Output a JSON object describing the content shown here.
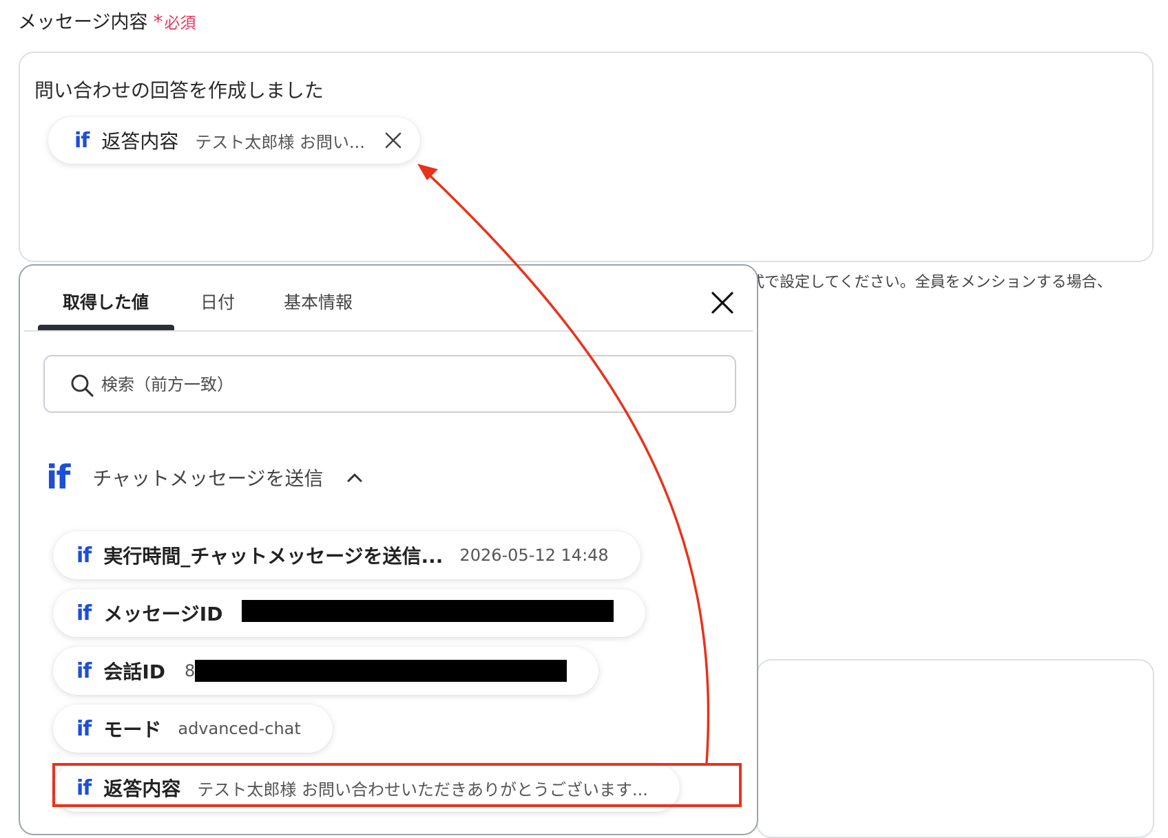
{
  "field": {
    "label": "メッセージ内容",
    "required_star": "*",
    "required_text": "必須",
    "text": "問い合わせの回答を作成しました",
    "inserted_var": {
      "icon": "if",
      "name": "返答内容",
      "value": "テスト太郎様 お問い..."
    },
    "helper_text": "式で設定してください。全員をメンションする場合、"
  },
  "picker": {
    "tabs": [
      "取得した値",
      "日付",
      "基本情報"
    ],
    "active_tab": 0,
    "search_placeholder": "検索（前方一致）",
    "group": {
      "icon": "if",
      "title": "チャットメッセージを送信"
    },
    "items": [
      {
        "icon": "if",
        "name": "実行時間_チャットメッセージを送信...",
        "value": "2026-05-12 14:48",
        "redacted": false
      },
      {
        "icon": "if",
        "name": "メッセージID",
        "value": "",
        "redacted": true
      },
      {
        "icon": "if",
        "name": "会話ID",
        "value": "8",
        "redacted": true
      },
      {
        "icon": "if",
        "name": "モード",
        "value": "advanced-chat",
        "redacted": false
      },
      {
        "icon": "if",
        "name": "返答内容",
        "value": "テスト太郎様 お問い合わせいただきありがとうございます...",
        "redacted": false
      }
    ]
  },
  "colors": {
    "accent_blue": "#1d4ed8",
    "required_red": "#e8365e",
    "annotation_red": "#e8321c"
  },
  "icons": {
    "chip_remove": "close-icon",
    "picker_close": "close-icon",
    "search": "search-icon",
    "group_toggle": "chevron-up-icon"
  }
}
